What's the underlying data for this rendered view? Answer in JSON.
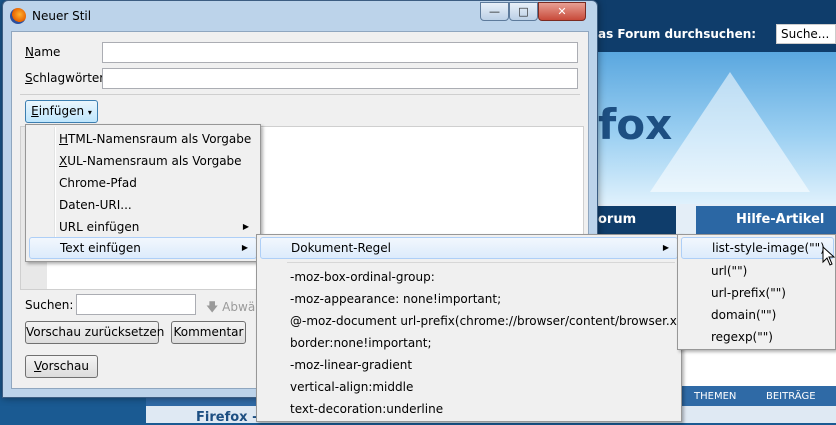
{
  "background_page": {
    "search_label": "as Forum durchsuchen:",
    "search_placeholder": "Suche...",
    "logo_text": "fox",
    "nav_tab_forum": "orum",
    "nav_tab_help": "Hilfe-Artikel",
    "table_headers": [
      "THEMEN",
      "BEITRÄGE"
    ],
    "row_text": "Firefox - ..."
  },
  "window": {
    "title": "Neuer Stil",
    "controls": {
      "minimize": "—",
      "maximize": "□",
      "close": "✕"
    }
  },
  "form": {
    "name_label_prefix": "N",
    "name_label_rest": "ame",
    "name_value": "",
    "tags_label_prefix": "S",
    "tags_label_rest": "chlagwörter",
    "tags_value": "",
    "insert_button_prefix": "E",
    "insert_button_rest": "infügen",
    "insert_button_arrow": "▾",
    "search_label": "Suchen:",
    "search_value": "",
    "search_down_label": "Abwä",
    "reset_preview_button": "Vorschau zurücksetzen",
    "comment_button": "Kommentar",
    "preview_button_prefix": "V",
    "preview_button_rest": "orschau"
  },
  "insert_menu": {
    "items": [
      {
        "prefix": "H",
        "rest": "TML-Namensraum als Vorgabe",
        "submenu": false
      },
      {
        "prefix": "X",
        "rest": "UL-Namensraum als Vorgabe",
        "submenu": false
      },
      {
        "prefix": "",
        "rest": "Chrome-Pfad",
        "submenu": false
      },
      {
        "prefix": "",
        "rest": "Daten-URI...",
        "submenu": false
      },
      {
        "prefix": "",
        "rest": "URL einfügen",
        "submenu": true
      },
      {
        "prefix": "",
        "rest": "Text einfügen",
        "submenu": true,
        "highlighted": true
      }
    ]
  },
  "text_menu": {
    "first": "Dokument-Regel",
    "items": [
      "-moz-box-ordinal-group:",
      "-moz-appearance: none!important;",
      "@-moz-document url-prefix(chrome://browser/content/browser.xul)",
      "border:none!important;",
      "-moz-linear-gradient",
      "vertical-align:middle",
      "text-decoration:underline"
    ]
  },
  "rule_menu": {
    "items": [
      "list-style-image(\"\")",
      "url(\"\")",
      "url-prefix(\"\")",
      "domain(\"\")",
      "regexp(\"\")"
    ]
  },
  "icons": [
    "firefox-icon",
    "minimize-icon",
    "maximize-icon",
    "close-icon",
    "arrow-down-icon",
    "submenu-arrow-icon",
    "mouse-cursor-icon"
  ],
  "colors": {
    "highlight": "#dcebfc",
    "title_bar": "#bcd3ea",
    "page_header": "#0f3d6b"
  }
}
